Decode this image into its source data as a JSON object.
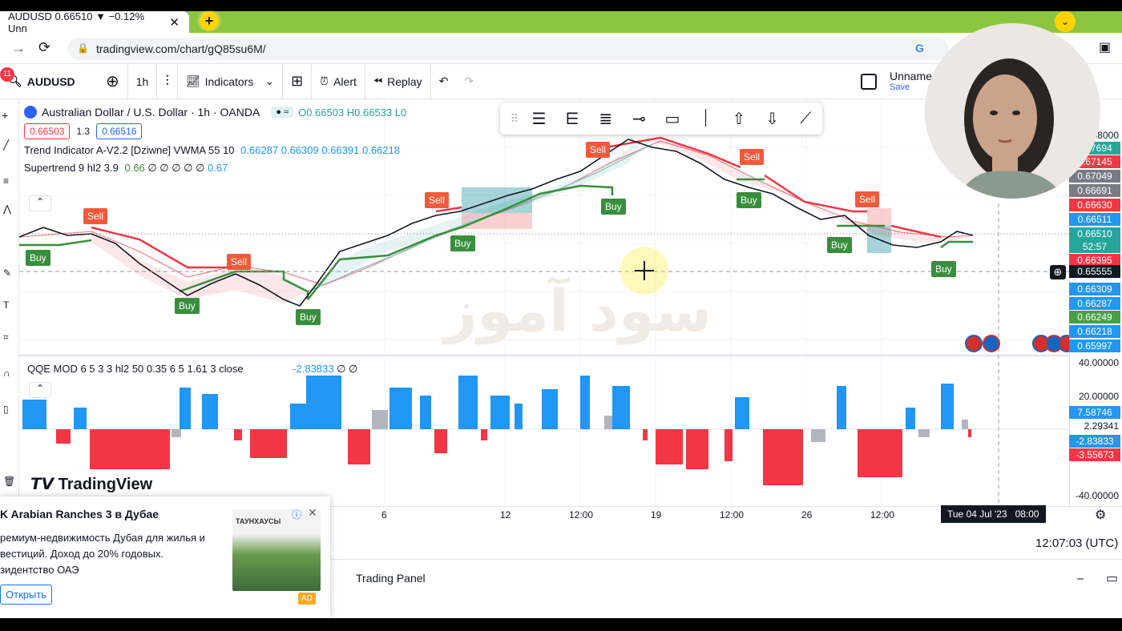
{
  "browser": {
    "tab_title": "AUDUSD 0.66510 ▼ −0.12% Unn",
    "tab_close": "✕",
    "new_tab": "+",
    "url": "tradingview.com/chart/gQ85su6M/",
    "notif_count": "11"
  },
  "header": {
    "symbol": "AUDUSD",
    "interval": "1h",
    "indicators": "Indicators",
    "alert": "Alert",
    "replay": "Replay",
    "layout_name": "Unnamed",
    "save": "Save"
  },
  "legend": {
    "title": "Australian Dollar / U.S. Dollar · 1h · OANDA",
    "ohlc": "O0.66503 H0.66533 L0",
    "bid": "0.66503",
    "spread": "1.3",
    "ask": "0.66516",
    "ind1": "Trend Indicator A-V2.2 [Dziwne] VWMA 55 10",
    "ind1_vals": "0.66287 0.66309 0.66391 0.66218",
    "ind2": "Supertrend 9 hl2 3.9",
    "ind2_v1": "0.66",
    "ind2_zeros": "∅ ∅ ∅ ∅ ∅",
    "ind2_v2": "0.67",
    "qqe": "QQE MOD 6 5 3 3 hl2 50 0.35 6 5 1.61 3 close",
    "qqe_val": "-2.83833",
    "qqe_zeros": "∅ ∅"
  },
  "signals": {
    "buy": "Buy",
    "sell": "Sell"
  },
  "price_axis": {
    "top": "0.68000",
    "labels": [
      "0.67694",
      "0.67145",
      "0.67049",
      "0.66691",
      "0.66630",
      "0.66511",
      "0.66510",
      "52:57",
      "0.66395",
      "0.65555",
      "0.66309",
      "0.66287",
      "0.66249",
      "0.66218",
      "0.65997"
    ],
    "colors": [
      "#26a69a",
      "#f23645",
      "#787b86",
      "#787b86",
      "#f23645",
      "#2196f3",
      "#26a69a",
      "#26a69a",
      "#f23645",
      "#131722",
      "#2196f3",
      "#2196f3",
      "#43a047",
      "#2196f3",
      "#2196f3"
    ],
    "osc": [
      "40.00000",
      "20.00000",
      "7.58746",
      "2.29341",
      "-2.83833",
      "-3.55673",
      "-40.00000"
    ]
  },
  "time_axis": {
    "ticks": [
      "6",
      "12",
      "12:00",
      "19",
      "12:00",
      "26",
      "12:00"
    ],
    "cursor": "Tue 04 Jul '23   08:00",
    "clock": "12:07:03 (UTC)"
  },
  "watermark": "سود آموز",
  "brand": "TradingView",
  "ad": {
    "title": "K Arabian Ranches 3 в Дубае",
    "line1": "ремиум-недвижимость Дубая для жилья и",
    "line2": "вестиций. Доход до 20% годовых.",
    "line3": "зидентство ОАЭ",
    "button": "Открыть",
    "badge": "AD",
    "image_text": "ТАУНХАУСЫ"
  },
  "trading_panel": "Trading Panel"
}
